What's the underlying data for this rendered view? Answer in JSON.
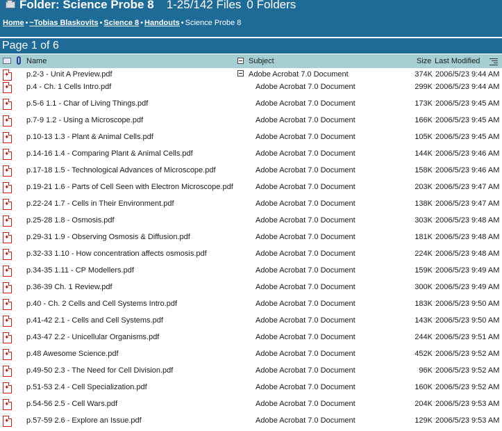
{
  "header": {
    "folder_title": "Folder: Science Probe 8",
    "file_count": "1-25/142 Files",
    "folder_count": "0 Folders"
  },
  "breadcrumb": {
    "items": [
      "Home",
      "~Tobias Blaskovits",
      "Science 8",
      "Handouts"
    ],
    "current": "Science Probe 8",
    "separator": "•"
  },
  "pagination": {
    "label": "Page 1 of 6"
  },
  "columns": {
    "name": "Name",
    "subject": "Subject",
    "size": "Size",
    "modified": "Last Modified"
  },
  "files": [
    {
      "name": "p.2-3 - Unit A Preview.pdf",
      "subject": "Adobe Acrobat 7.0 Document",
      "size": "374K",
      "modified": "2006/5/23 9:44 AM"
    },
    {
      "name": "p.4 - Ch. 1 Cells Intro.pdf",
      "subject": "Adobe Acrobat 7.0 Document",
      "size": "299K",
      "modified": "2006/5/23 9:44 AM"
    },
    {
      "name": "p.5-6 1.1 - Char of Living Things.pdf",
      "subject": "Adobe Acrobat 7.0 Document",
      "size": "173K",
      "modified": "2006/5/23 9:45 AM"
    },
    {
      "name": "p.7-9 1.2 - Using a Microscope.pdf",
      "subject": "Adobe Acrobat 7.0 Document",
      "size": "166K",
      "modified": "2006/5/23 9:45 AM"
    },
    {
      "name": "p.10-13 1.3 - Plant & Animal Cells.pdf",
      "subject": "Adobe Acrobat 7.0 Document",
      "size": "105K",
      "modified": "2006/5/23 9:45 AM"
    },
    {
      "name": "p.14-16 1.4 - Comparing Plant & Animal Cells.pdf",
      "subject": "Adobe Acrobat 7.0 Document",
      "size": "144K",
      "modified": "2006/5/23 9:46 AM"
    },
    {
      "name": "p.17-18 1.5 - Technological Advances of Microscope.pdf",
      "subject": "Adobe Acrobat 7.0 Document",
      "size": "158K",
      "modified": "2006/5/23 9:46 AM"
    },
    {
      "name": "p.19-21 1.6 - Parts of Cell Seen with Electron Microscope.pdf",
      "subject": "Adobe Acrobat 7.0 Document",
      "size": "203K",
      "modified": "2006/5/23 9:47 AM"
    },
    {
      "name": "p.22-24 1.7 - Cells in Their Environment.pdf",
      "subject": "Adobe Acrobat 7.0 Document",
      "size": "138K",
      "modified": "2006/5/23 9:47 AM"
    },
    {
      "name": "p.25-28 1.8 - Osmosis.pdf",
      "subject": "Adobe Acrobat 7.0 Document",
      "size": "303K",
      "modified": "2006/5/23 9:48 AM"
    },
    {
      "name": "p.29-31 1.9 - Observing Osmosis & Diffusion.pdf",
      "subject": "Adobe Acrobat 7.0 Document",
      "size": "181K",
      "modified": "2006/5/23 9:48 AM"
    },
    {
      "name": "p.32-33 1.10 - How concentration affects osmosis.pdf",
      "subject": "Adobe Acrobat 7.0 Document",
      "size": "224K",
      "modified": "2006/5/23 9:48 AM"
    },
    {
      "name": "p.34-35 1.11 - CP Modellers.pdf",
      "subject": "Adobe Acrobat 7.0 Document",
      "size": "159K",
      "modified": "2006/5/23 9:49 AM"
    },
    {
      "name": "p.36-39 Ch. 1 Review.pdf",
      "subject": "Adobe Acrobat 7.0 Document",
      "size": "300K",
      "modified": "2006/5/23 9:49 AM"
    },
    {
      "name": "p.40 - Ch. 2 Cells and Cell Systems Intro.pdf",
      "subject": "Adobe Acrobat 7.0 Document",
      "size": "183K",
      "modified": "2006/5/23 9:50 AM"
    },
    {
      "name": "p.41-42 2.1 - Cells and Cell Systems.pdf",
      "subject": "Adobe Acrobat 7.0 Document",
      "size": "143K",
      "modified": "2006/5/23 9:50 AM"
    },
    {
      "name": "p.43-47 2.2 - Unicellular Organisms.pdf",
      "subject": "Adobe Acrobat 7.0 Document",
      "size": "244K",
      "modified": "2006/5/23 9:51 AM"
    },
    {
      "name": "p.48 Awesome Science.pdf",
      "subject": "Adobe Acrobat 7.0 Document",
      "size": "452K",
      "modified": "2006/5/23 9:52 AM"
    },
    {
      "name": "p.49-50 2.3 - The Need for Cell Division.pdf",
      "subject": "Adobe Acrobat 7.0 Document",
      "size": "96K",
      "modified": "2006/5/23 9:52 AM"
    },
    {
      "name": "p.51-53 2.4 - Cell Specialization.pdf",
      "subject": "Adobe Acrobat 7.0 Document",
      "size": "160K",
      "modified": "2006/5/23 9:52 AM"
    },
    {
      "name": "p.54-56 2.5 - Cell Wars.pdf",
      "subject": "Adobe Acrobat 7.0 Document",
      "size": "204K",
      "modified": "2006/5/23 9:53 AM"
    },
    {
      "name": "p.57-59 2.6 - Explore an Issue.pdf",
      "subject": "Adobe Acrobat 7.0 Document",
      "size": "129K",
      "modified": "2006/5/23 9:53 AM"
    }
  ],
  "colors": {
    "header_bg": "#1e6b97",
    "column_header_bg": "#a6cfd4",
    "pdf_icon": "#c71b14"
  },
  "icons": {
    "folder": "folder-icon",
    "file": "pdf-icon",
    "attachment": "paperclip-icon",
    "view": "view-mode-icon",
    "collapse": "collapse-icon",
    "column_options": "column-options-icon"
  }
}
